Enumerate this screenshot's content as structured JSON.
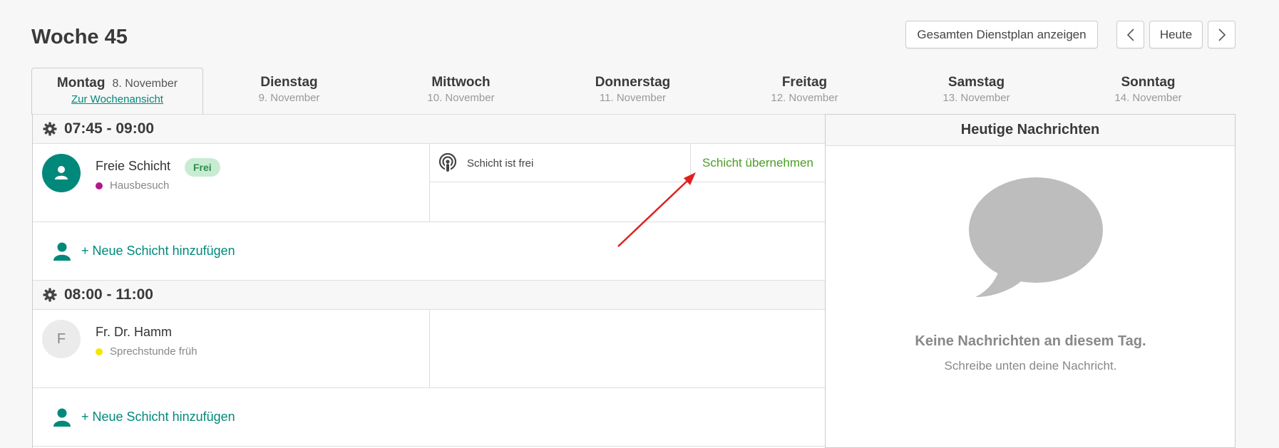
{
  "header": {
    "week_title": "Woche 45",
    "plan_button": "Gesamten Dienstplan anzeigen",
    "today_button": "Heute"
  },
  "days": [
    {
      "name": "Montag",
      "date": "8. November",
      "link": "Zur Wochenansicht",
      "active": true
    },
    {
      "name": "Dienstag",
      "date": "9. November"
    },
    {
      "name": "Mittwoch",
      "date": "10. November"
    },
    {
      "name": "Donnerstag",
      "date": "11. November"
    },
    {
      "name": "Freitag",
      "date": "12. November"
    },
    {
      "name": "Samstag",
      "date": "13. November"
    },
    {
      "name": "Sonntag",
      "date": "14. November"
    }
  ],
  "slots": [
    {
      "time": "07:45 - 09:00",
      "shift": {
        "name": "Freie Schicht",
        "badge": "Frei",
        "type": "Hausbesuch",
        "type_color": "#b5178a",
        "status": "Schicht ist frei",
        "action": "Schicht übernehmen"
      },
      "add_label": "+ Neue Schicht hinzufügen"
    },
    {
      "time": "08:00 - 11:00",
      "shift": {
        "avatar_letter": "F",
        "name": "Fr. Dr. Hamm",
        "type": "Sprechstunde früh",
        "type_color": "#f2e600"
      },
      "add_label": "+ Neue Schicht hinzufügen"
    }
  ],
  "news": {
    "title": "Heutige Nachrichten",
    "empty_title": "Keine Nachrichten an diesem Tag.",
    "empty_sub": "Schreibe unten deine Nachricht."
  },
  "colors": {
    "accent": "#00897b",
    "action_green": "#4a9d25",
    "annotation_arrow": "#e02020"
  }
}
